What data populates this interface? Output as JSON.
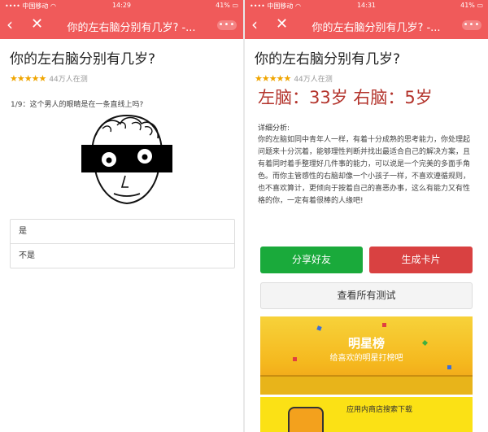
{
  "left": {
    "status": {
      "carrier": "中国移动",
      "time": "14:29",
      "battery": "41%"
    },
    "header_title": "你的左右脑分别有几岁? -...",
    "page_title": "你的左右脑分别有几岁?",
    "participants": "44万人在测",
    "question": "1/9：这个男人的眼睛是在一条直线上吗?",
    "options": [
      "是",
      "不是"
    ]
  },
  "right": {
    "status": {
      "carrier": "中国移动",
      "time": "14:31",
      "battery": "41%"
    },
    "header_title": "你的左右脑分别有几岁? -...",
    "page_title": "你的左右脑分别有几岁?",
    "participants": "44万人在测",
    "result": "左脑：33岁 右脑：5岁",
    "analysis_label": "详细分析:",
    "analysis_text": "你的左脑如同中青年人一样，有着十分成熟的思考能力，你处理起问题来十分沉着，能够理性判断并找出最适合自己的解决方案，且有着同时着手整理好几件事的能力，可以说是一个完美的多面手角色。而你主管感性的右脑却像一个小孩子一样，不喜欢遵循规则，也不喜欢算计，更倾向于按着自己的喜恶办事，这么有能力又有性格的你，一定有着很棒的人缘吧!",
    "share_label": "分享好友",
    "card_label": "生成卡片",
    "all_tests_label": "查看所有测试",
    "banner1_title": "明星榜",
    "banner1_sub": "给喜欢的明星打榜吧",
    "banner2_text": "应用内商店搜索下载"
  },
  "colors": {
    "header": "#f05a5a",
    "share": "#1aaa3b",
    "card": "#d94141",
    "result": "#b3332b",
    "stars": "#f0a500"
  },
  "icons": [
    "signal-icon",
    "wifi-icon",
    "back-arrow-icon",
    "close-icon",
    "more-icon",
    "star-icon",
    "battery-icon"
  ]
}
